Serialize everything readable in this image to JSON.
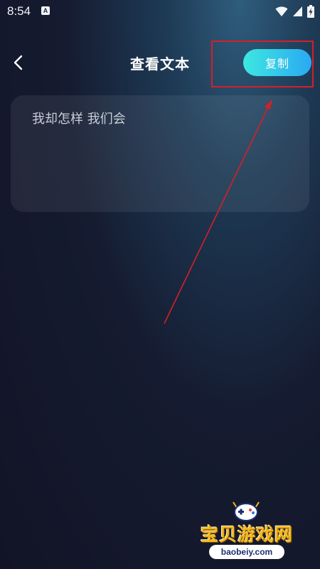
{
  "status_bar": {
    "time": "8:54",
    "notification_icon_letter": "A",
    "icons": [
      "wifi-icon",
      "cellular-signal-icon",
      "battery-charging-icon"
    ]
  },
  "header": {
    "back_icon": "chevron-left-icon",
    "title": "查看文本",
    "copy_label": "复制"
  },
  "card": {
    "text": "我却怎样 我们会"
  },
  "watermark": {
    "title": "宝贝游戏网",
    "domain": "baobeiy.com"
  },
  "colors": {
    "accent_start": "#3de8e0",
    "accent_end": "#2aa9f2",
    "annotation": "#d61f26",
    "background": "#151b30"
  }
}
